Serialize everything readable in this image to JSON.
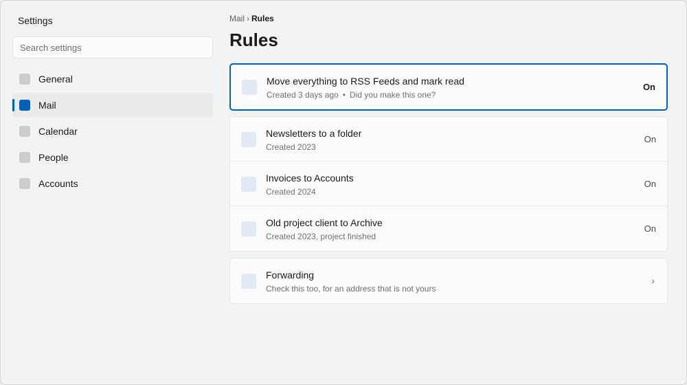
{
  "sidebar": {
    "title": "Settings",
    "search_placeholder": "Search settings",
    "items": [
      {
        "label": "General",
        "icon": "general-icon",
        "active": false
      },
      {
        "label": "Mail",
        "icon": "mail-icon",
        "active": true
      },
      {
        "label": "Calendar",
        "icon": "calendar-icon",
        "active": false
      },
      {
        "label": "People",
        "icon": "people-icon",
        "active": false
      },
      {
        "label": "Accounts",
        "icon": "accounts-icon",
        "active": false
      }
    ]
  },
  "breadcrumb": {
    "parent": "Mail",
    "separator": "›",
    "current": "Rules"
  },
  "page_title": "Rules",
  "selected_rule": {
    "title": "Move everything to RSS Feeds and mark read",
    "created": "Created 3 days ago",
    "dot": "•",
    "note": "Did you make this one?",
    "status": "On"
  },
  "rules": [
    {
      "title": "Newsletters to a folder",
      "subtitle": "Created 2023",
      "status": "On"
    },
    {
      "title": "Invoices to Accounts",
      "subtitle": "Created 2024",
      "status": "On"
    },
    {
      "title": "Old project client to Archive",
      "subtitle": "Created 2023, project finished",
      "status": "On"
    }
  ],
  "forwarding": {
    "title": "Forwarding",
    "subtitle": "Check this too, for an address that is not yours",
    "chevron": "›"
  },
  "colors": {
    "accent": "#005fb8",
    "placeholder_icon": "#e2e9f4",
    "window_bg": "#f3f3f3"
  }
}
